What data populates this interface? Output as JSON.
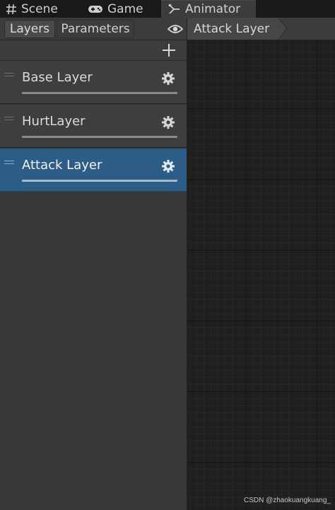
{
  "window_tabs": [
    {
      "label": "Scene",
      "icon": "hash-icon"
    },
    {
      "label": "Game",
      "icon": "gamepad-icon"
    },
    {
      "label": "Animator",
      "icon": "animator-icon",
      "active": true
    }
  ],
  "left_panel": {
    "tabs": [
      {
        "label": "Layers",
        "active": true
      },
      {
        "label": "Parameters",
        "active": false
      }
    ],
    "add_icon": "plus-icon",
    "layers": [
      {
        "name": "Base Layer",
        "selected": false,
        "weight": 1.0
      },
      {
        "name": "HurtLayer",
        "selected": false,
        "weight": 1.0
      },
      {
        "name": "Attack Layer",
        "selected": true,
        "weight": 1.0
      }
    ]
  },
  "graph": {
    "eye_icon": "eye-icon",
    "breadcrumb": "Attack Layer"
  },
  "watermark": "CSDN @zhaokuangkuang_",
  "colors": {
    "selected_layer": "#2c5d87",
    "panel_bg": "#383838",
    "grid_bg": "#1f1f1f"
  }
}
